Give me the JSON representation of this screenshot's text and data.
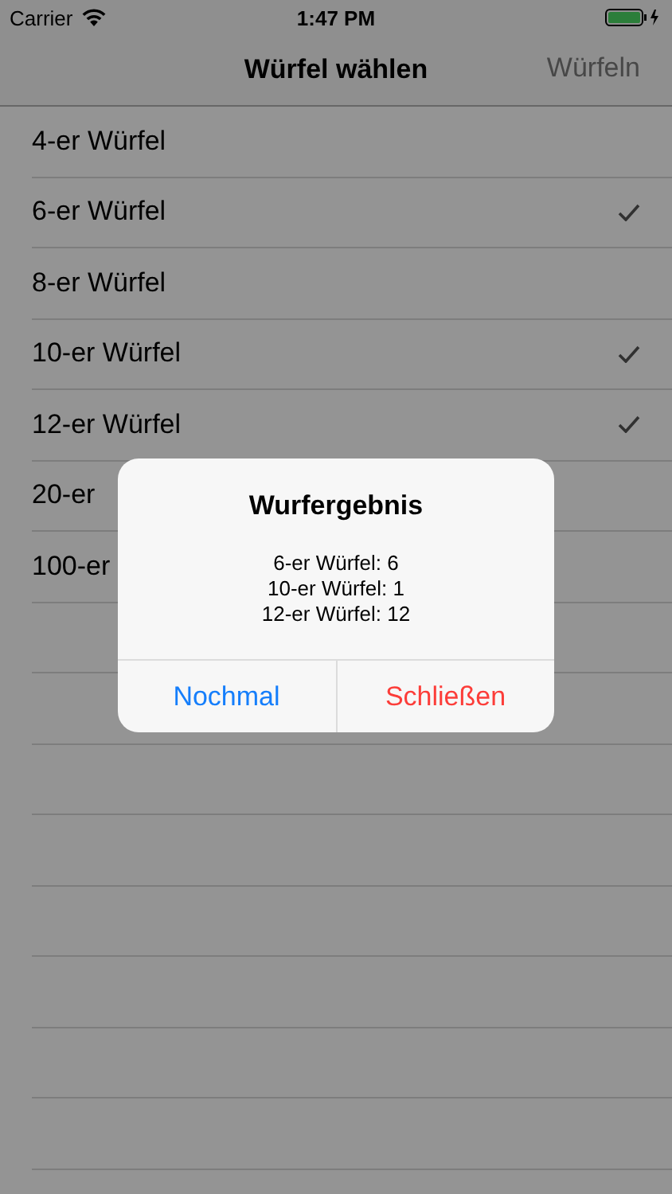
{
  "status_bar": {
    "carrier": "Carrier",
    "time": "1:47 PM"
  },
  "nav": {
    "title": "Würfel wählen",
    "action": {
      "label": "Würfeln",
      "disabled": true
    }
  },
  "dice": [
    {
      "label": "4-er Würfel",
      "checked": false
    },
    {
      "label": "6-er Würfel",
      "checked": true
    },
    {
      "label": "8-er Würfel",
      "checked": false
    },
    {
      "label": "10-er Würfel",
      "checked": true
    },
    {
      "label": "12-er Würfel",
      "checked": true
    },
    {
      "label": "20-er",
      "checked": false
    },
    {
      "label": "100-er",
      "checked": false
    }
  ],
  "alert": {
    "title": "Wurfergebnis",
    "lines": [
      "6-er Würfel: 6",
      "10-er Würfel: 1",
      "12-er Würfel: 12"
    ],
    "buttons": [
      {
        "label": "Nochmal",
        "kind": "default"
      },
      {
        "label": "Schließen",
        "kind": "destructive"
      }
    ]
  }
}
